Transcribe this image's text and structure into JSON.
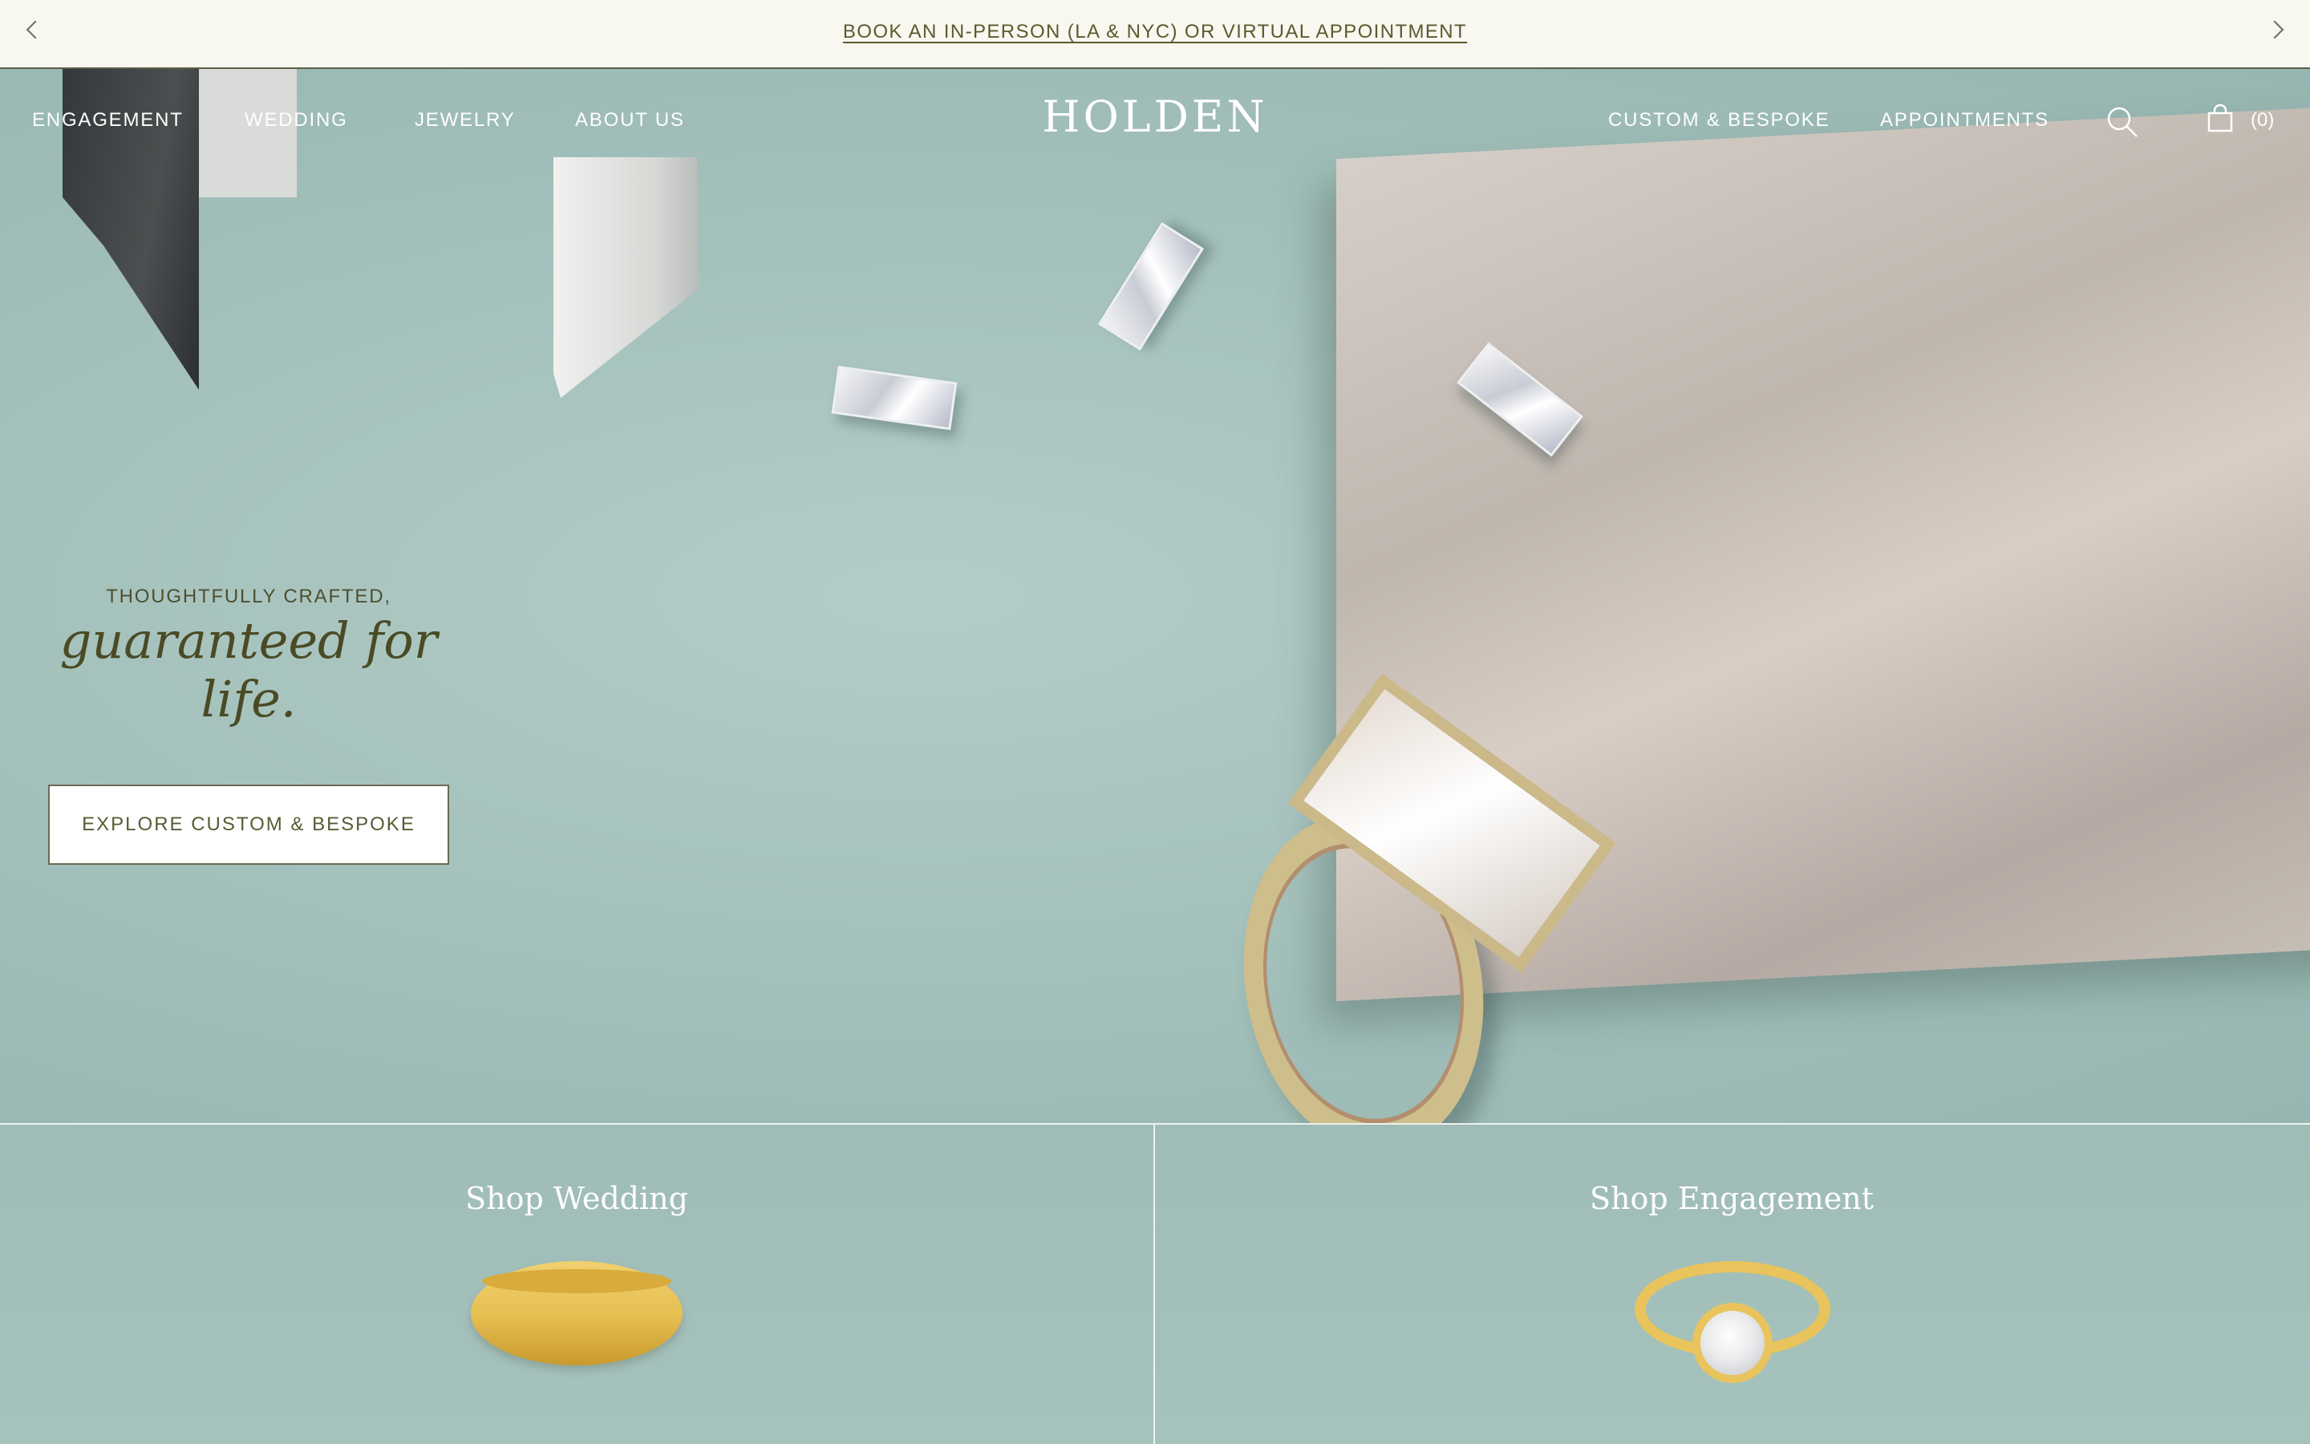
{
  "announcement": {
    "text": "BOOK AN IN-PERSON (LA & NYC) OR VIRTUAL APPOINTMENT"
  },
  "nav": {
    "left_items": [
      "ENGAGEMENT",
      "WEDDING",
      "JEWELRY",
      "ABOUT US"
    ],
    "logo": "HOLDEN",
    "right_items": [
      "CUSTOM & BESPOKE",
      "APPOINTMENTS"
    ],
    "cart_count": "(0)",
    "icons": [
      "search-icon",
      "cart-icon"
    ]
  },
  "hero": {
    "eyebrow": "THOUGHTFULLY CRAFTED,",
    "headline": "guaranteed for life.",
    "cta": "EXPLORE CUSTOM & BESPOKE"
  },
  "categories": [
    {
      "title": "Shop Wedding"
    },
    {
      "title": "Shop Engagement"
    }
  ],
  "colors": {
    "announcement_bg": "#f8f7f0",
    "text_olive": "#4a4b25",
    "hero_bg": "#a7c2bd",
    "white": "#ffffff"
  }
}
